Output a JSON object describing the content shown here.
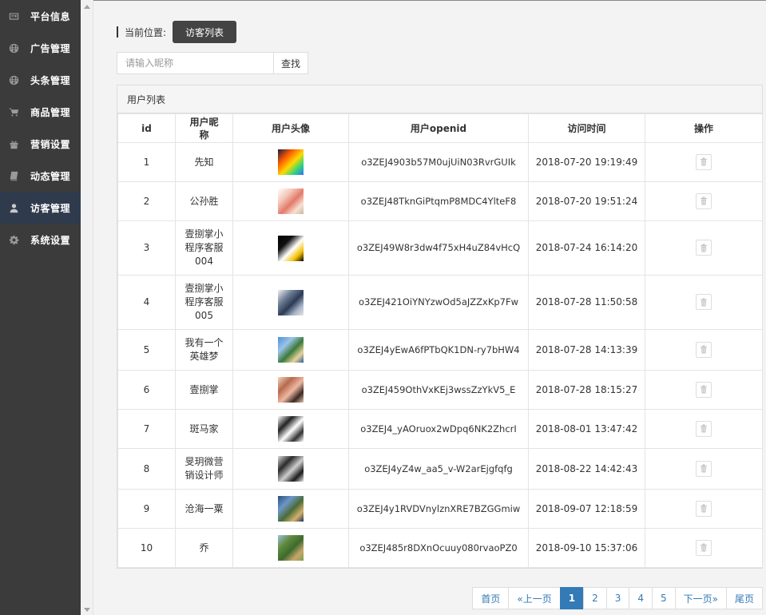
{
  "sidebar": {
    "items": [
      {
        "label": "平台信息",
        "icon": "id-card-icon",
        "active": false
      },
      {
        "label": "广告管理",
        "icon": "globe-icon",
        "active": false
      },
      {
        "label": "头条管理",
        "icon": "globe-icon",
        "active": false
      },
      {
        "label": "商品管理",
        "icon": "cart-icon",
        "active": false
      },
      {
        "label": "营销设置",
        "icon": "gift-icon",
        "active": false
      },
      {
        "label": "动态管理",
        "icon": "book-icon",
        "active": false
      },
      {
        "label": "访客管理",
        "icon": "user-icon",
        "active": true
      },
      {
        "label": "系统设置",
        "icon": "gear-icon",
        "active": false
      }
    ]
  },
  "breadcrumb": {
    "label": "当前位置:",
    "current": "访客列表"
  },
  "search": {
    "placeholder": "请输入昵称",
    "button": "查找"
  },
  "panel": {
    "title": "用户列表"
  },
  "table": {
    "headers": [
      "id",
      "用户昵称",
      "用户头像",
      "用户openid",
      "访问时间",
      "操作"
    ],
    "rows": [
      {
        "id": "1",
        "nickname": "先知",
        "openid": "o3ZEJ4903b57M0ujUiN03RvrGUIk",
        "time": "2018-07-20 19:19:49",
        "avatar_colors": [
          "#1a1a40",
          "#ff5a00",
          "#ffd800",
          "#2bd67b",
          "#3a6bff"
        ]
      },
      {
        "id": "2",
        "nickname": "公孙胜",
        "openid": "o3ZEJ48TknGiPtqmP8MDC4YlteF8",
        "time": "2018-07-20 19:51:24",
        "avatar_colors": [
          "#ffffff",
          "#f4c7b8",
          "#e47a6a",
          "#f7e0d0",
          "#c9b6a5"
        ]
      },
      {
        "id": "3",
        "nickname": "壹捌掌小程序客服004",
        "openid": "o3ZEJ49W8r3dw4f75xH4uZ84vHcQ",
        "time": "2018-07-24 16:14:20",
        "avatar_colors": [
          "#000000",
          "#111111",
          "#ffffff",
          "#f3c000",
          "#000000"
        ]
      },
      {
        "id": "4",
        "nickname": "壹捌掌小程序客服005",
        "openid": "o3ZEJ421OiYNYzwOd5aJZZxKp7Fw",
        "time": "2018-07-28 11:50:58",
        "avatar_colors": [
          "#f2f2f2",
          "#6f7f96",
          "#2c3b55",
          "#a7b4c9",
          "#e6e6e6"
        ]
      },
      {
        "id": "5",
        "nickname": "我有一个英雄梦",
        "openid": "o3ZEJ4yEwA6fPTbQK1DN-ry7bHW4",
        "time": "2018-07-28 14:13:39",
        "avatar_colors": [
          "#4a8fd8",
          "#9cc3ea",
          "#3c7a3a",
          "#e9d39c",
          "#2f5f9a"
        ]
      },
      {
        "id": "6",
        "nickname": "壹捌掌",
        "openid": "o3ZEJ459OthVxKEj3wssZzYkV5_E",
        "time": "2018-07-28 18:15:27",
        "avatar_colors": [
          "#f5d6c4",
          "#b66a4e",
          "#f0b8a2",
          "#3a2a24",
          "#e8c2a8"
        ]
      },
      {
        "id": "7",
        "nickname": "斑马家",
        "openid": "o3ZEJ4_yAOruox2wDpq6NK2ZhcrI",
        "time": "2018-08-01 13:47:42",
        "avatar_colors": [
          "#ffffff",
          "#222222",
          "#ffffff",
          "#333333",
          "#ffffff"
        ]
      },
      {
        "id": "8",
        "nickname": "旻玥微营销设计师",
        "openid": "o3ZEJ4yZ4w_aa5_v-W2arEjgfqfg",
        "time": "2018-08-22 14:42:43",
        "avatar_colors": [
          "#d9d9d9",
          "#2a2a2a",
          "#cfcfcf",
          "#1d1d1d",
          "#e6e6e6"
        ]
      },
      {
        "id": "9",
        "nickname": "沧海一粟",
        "openid": "o3ZEJ4y1RVDVnylznXRE7BZGGmiw",
        "time": "2018-09-07 12:18:59",
        "avatar_colors": [
          "#2a4d7a",
          "#6d97c6",
          "#4a6b3a",
          "#d4b06a",
          "#1f3555"
        ]
      },
      {
        "id": "10",
        "nickname": "乔",
        "openid": "o3ZEJ485r8DXnOcuuy080rvaoPZ0",
        "time": "2018-09-10 15:37:06",
        "avatar_colors": [
          "#9cc0dc",
          "#5e8a3e",
          "#3e6a2e",
          "#c9a66b",
          "#7aa24e"
        ]
      }
    ]
  },
  "pager": {
    "items": [
      {
        "label": "首页",
        "active": false
      },
      {
        "label": "«上一页",
        "active": false
      },
      {
        "label": "1",
        "active": true
      },
      {
        "label": "2",
        "active": false
      },
      {
        "label": "3",
        "active": false
      },
      {
        "label": "4",
        "active": false
      },
      {
        "label": "5",
        "active": false
      },
      {
        "label": "下一页»",
        "active": false
      },
      {
        "label": "尾页",
        "active": false
      }
    ]
  },
  "colors": {
    "sidebar_bg": "#3b3b3b",
    "sidebar_active": "#2f3b4d",
    "pager_accent": "#337ab7"
  }
}
